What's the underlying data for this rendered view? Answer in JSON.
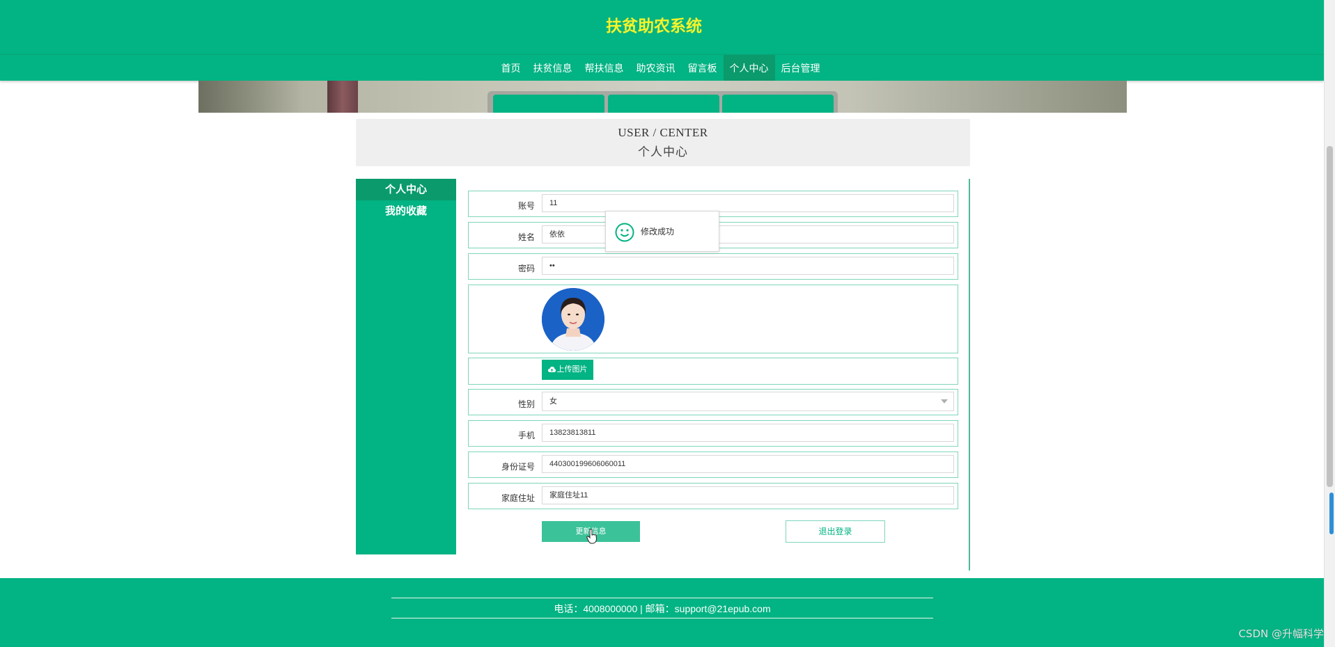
{
  "header": {
    "title": "扶贫助农系统"
  },
  "nav": {
    "items": [
      {
        "label": "首页"
      },
      {
        "label": "扶贫信息"
      },
      {
        "label": "帮扶信息"
      },
      {
        "label": "助农资讯"
      },
      {
        "label": "留言板"
      },
      {
        "label": "个人中心",
        "active": true
      },
      {
        "label": "后台管理"
      }
    ]
  },
  "page_heading": {
    "en": "USER / CENTER",
    "cn": "个人中心"
  },
  "sidebar": {
    "items": [
      {
        "label": "个人中心",
        "active": true
      },
      {
        "label": "我的收藏"
      }
    ]
  },
  "form": {
    "account": {
      "label": "账号",
      "value": "11"
    },
    "name": {
      "label": "姓名",
      "value": "依依"
    },
    "password": {
      "label": "密码",
      "value": "••"
    },
    "avatar": {
      "icon": "profile-photo"
    },
    "upload": {
      "label": "上传图片",
      "icon": "cloud-upload-icon"
    },
    "gender": {
      "label": "性别",
      "value": "女"
    },
    "phone": {
      "label": "手机",
      "value": "13823813811"
    },
    "id_number": {
      "label": "身份证号",
      "value": "440300199606060011"
    },
    "address": {
      "label": "家庭住址",
      "value": "家庭住址11"
    },
    "update_button": "更新信息",
    "logout_button": "退出登录"
  },
  "toast": {
    "text": "修改成功",
    "icon": "smile-icon"
  },
  "footer": {
    "text": "电话：4008000000 | 邮箱：support@21epub.com"
  },
  "watermark": "CSDN @升幅科学",
  "colors": {
    "primary": "#02b383",
    "title": "#f7f32a",
    "active": "#0a9a6c"
  }
}
